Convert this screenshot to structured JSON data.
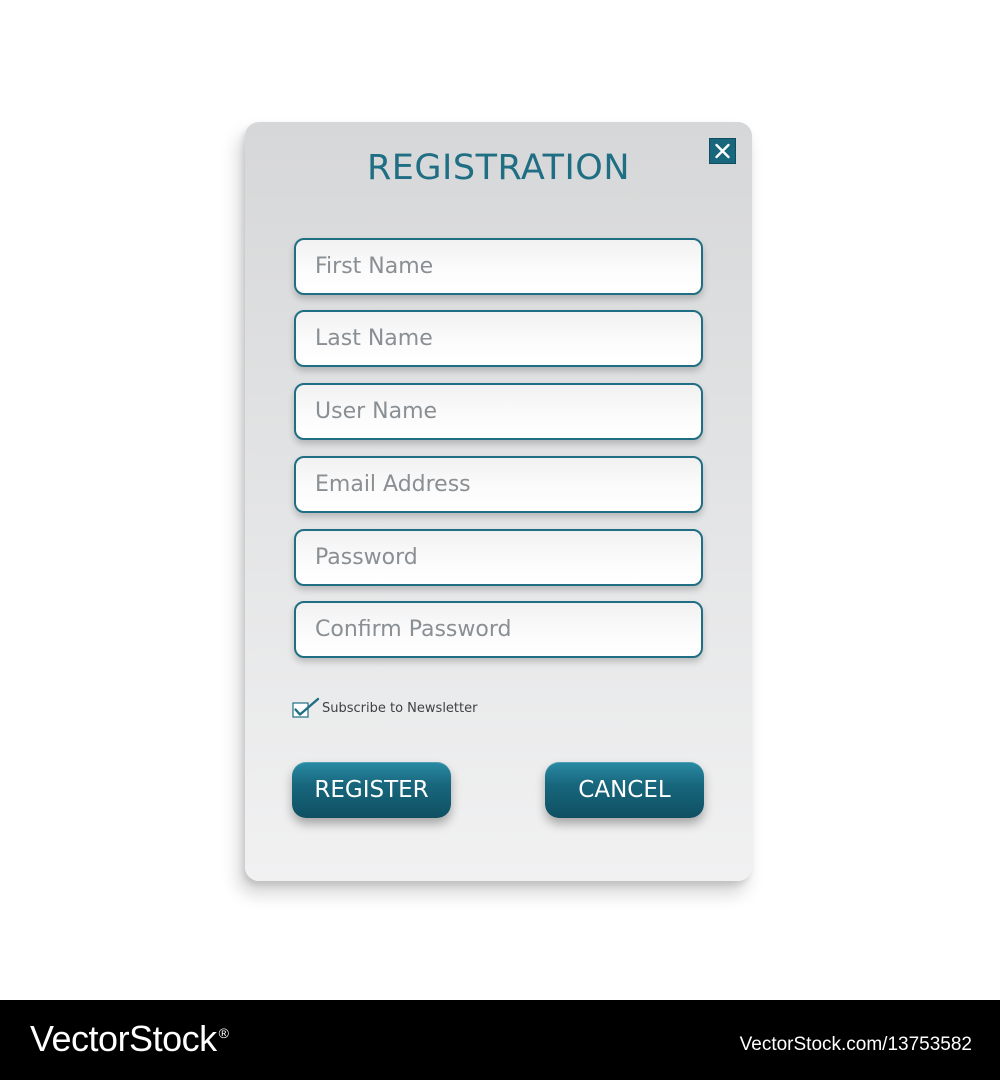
{
  "form": {
    "title": "REGISTRATION",
    "close_icon": "close-icon",
    "fields": [
      {
        "placeholder": "First Name",
        "value": ""
      },
      {
        "placeholder": "Last Name",
        "value": ""
      },
      {
        "placeholder": "User Name",
        "value": ""
      },
      {
        "placeholder": "Email Address",
        "value": ""
      },
      {
        "placeholder": "Password",
        "value": ""
      },
      {
        "placeholder": "Confirm Password",
        "value": ""
      }
    ],
    "newsletter": {
      "label": "Subscribe to Newsletter",
      "checked": true,
      "icon": "checkmark-icon"
    },
    "register_label": "REGISTER",
    "cancel_label": "CANCEL"
  },
  "colors": {
    "accent": "#1f6e83",
    "button": "#18677d",
    "card_top": "#d6d7d8",
    "card_bottom": "#f1f1f2"
  },
  "watermark": {
    "logo": "VectorStock",
    "registered_mark": "®",
    "url": "VectorStock.com/13753582"
  }
}
